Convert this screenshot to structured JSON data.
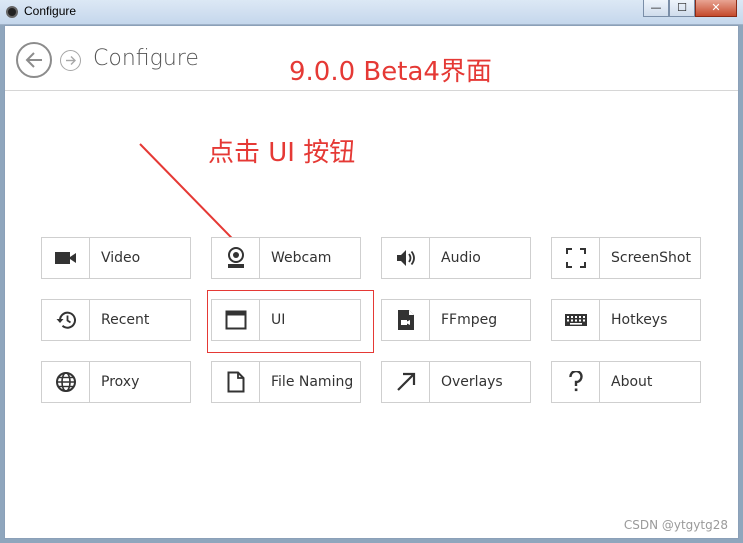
{
  "window": {
    "title": "Configure",
    "controls": {
      "minimize": "—",
      "maximize": "☐",
      "close": "✕"
    }
  },
  "header": {
    "title": "Configure",
    "back_icon": "back-arrow-icon",
    "forward_icon": "forward-arrow-icon"
  },
  "annotations": {
    "version": "9.0.0 Beta4界面",
    "instruction": "点击 UI 按钮",
    "color": "#e53935"
  },
  "tiles": [
    {
      "label": "Video",
      "icon": "video-camera-icon"
    },
    {
      "label": "Webcam",
      "icon": "webcam-icon"
    },
    {
      "label": "Audio",
      "icon": "speaker-icon"
    },
    {
      "label": "ScreenShot",
      "icon": "screenshot-icon"
    },
    {
      "label": "Recent",
      "icon": "history-icon"
    },
    {
      "label": "UI",
      "icon": "window-icon"
    },
    {
      "label": "FFmpeg",
      "icon": "ffmpeg-file-icon"
    },
    {
      "label": "Hotkeys",
      "icon": "keyboard-icon"
    },
    {
      "label": "Proxy",
      "icon": "globe-icon"
    },
    {
      "label": "File Naming",
      "icon": "document-icon"
    },
    {
      "label": "Overlays",
      "icon": "diagonal-arrow-icon"
    },
    {
      "label": "About",
      "icon": "question-icon"
    }
  ],
  "watermark": "CSDN @ytgytg28"
}
